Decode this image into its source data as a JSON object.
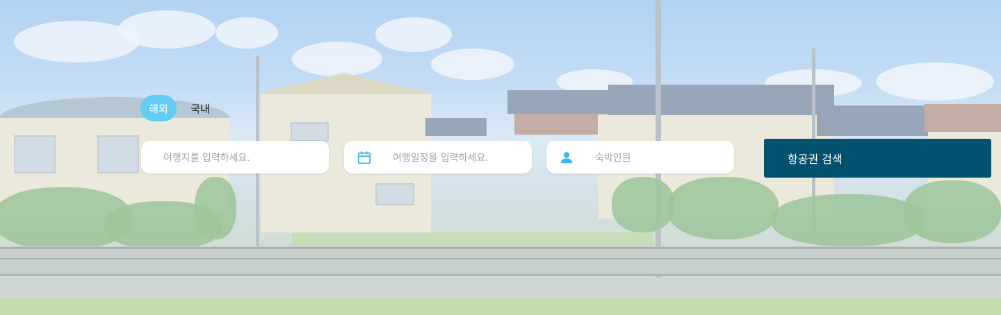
{
  "hero": {
    "background": "photo of residential houses with green hedges and a fenced canal under a blue sky",
    "colors": {
      "tab_active": "#63ccf2",
      "icon": "#39b7ec",
      "button": "#02516e"
    }
  },
  "tabs": [
    {
      "label": "해외",
      "active": true
    },
    {
      "label": "국내",
      "active": false
    }
  ],
  "search": {
    "destination_placeholder": "여행지를 입력하세요.",
    "dates_placeholder": "여행일정을 입력하세요.",
    "guests_placeholder": "숙박인원",
    "dates_icon": "calendar-icon",
    "guests_icon": "person-icon",
    "button_label": "항공권 검색"
  }
}
